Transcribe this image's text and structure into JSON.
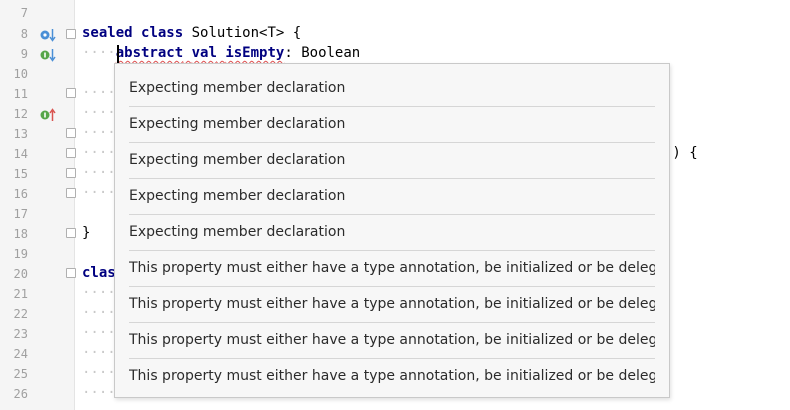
{
  "editor": {
    "line_numbers": [
      "7",
      "8",
      "9",
      "10",
      "11",
      "12",
      "13",
      "14",
      "15",
      "16",
      "17",
      "18",
      "19",
      "20",
      "21",
      "22",
      "23",
      "24",
      "25",
      "26"
    ],
    "line8": {
      "kw1": "sealed",
      "kw2": "class",
      "rest": "Solution<T>",
      "brace": "{"
    },
    "line9": {
      "kw1": "abstract",
      "kw2": "val",
      "name": "isEmpty",
      "colon": ":",
      "type": "Boolean"
    },
    "line14_tail": "() {",
    "line18": "}",
    "line20": "clas",
    "whitespace_dots": "····",
    "gutter_icons": [
      {
        "line": "8",
        "name": "implemented-down-icon",
        "color": "#4a8fd6"
      },
      {
        "line": "9",
        "name": "implemented-down-icon",
        "color": "#57a64a"
      },
      {
        "line": "12",
        "name": "overrides-up-icon",
        "color": "#57a64a"
      }
    ]
  },
  "popup": {
    "items": [
      "Expecting member declaration",
      "Expecting member declaration",
      "Expecting member declaration",
      "Expecting member declaration",
      "Expecting member declaration",
      "This property must either have a type annotation, be initialized or be delegated",
      "This property must either have a type annotation, be initialized or be delegated",
      "This property must either have a type annotation, be initialized or be delegated",
      "This property must either have a type annotation, be initialized or be delegated"
    ]
  }
}
